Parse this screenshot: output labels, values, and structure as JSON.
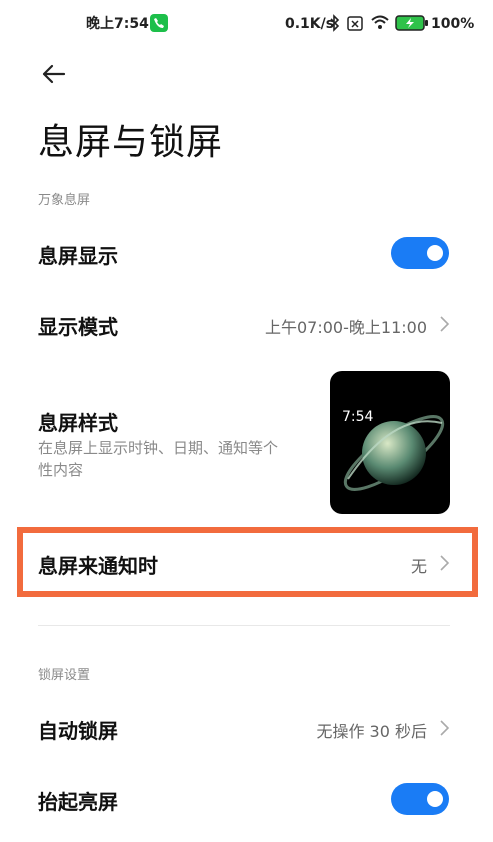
{
  "status_bar": {
    "time": "晚上7:54",
    "net_speed": "0.1K/s",
    "battery_pct": "100%"
  },
  "page": {
    "title": "息屏与锁屏"
  },
  "section_aod": {
    "header": "万象息屏",
    "aod_display": {
      "label": "息屏显示",
      "enabled": true
    },
    "display_mode": {
      "label": "显示模式",
      "value": "上午07:00-晚上11:00"
    },
    "aod_style": {
      "label": "息屏样式",
      "description_line1": "在息屏上显示时钟、日期、通知等个",
      "description_line2": "性内容",
      "preview_time": "7:54"
    },
    "on_notification": {
      "label": "息屏来通知时",
      "value": "无"
    }
  },
  "section_lock": {
    "header": "锁屏设置",
    "auto_lock": {
      "label": "自动锁屏",
      "value": "无操作 30 秒后"
    },
    "raise_to_wake": {
      "label": "抬起亮屏",
      "enabled": true
    }
  },
  "colors": {
    "accent": "#1a7cf5",
    "highlight": "#f26b3d",
    "call_icon": "#1dbf4a",
    "battery": "#2fc24a"
  }
}
